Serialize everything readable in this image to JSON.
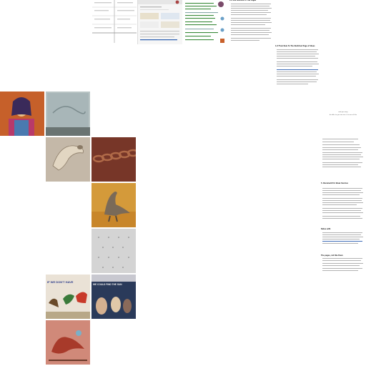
{
  "top_strip": {
    "doc_heading": "1.6 Use Stitched To The Pages",
    "browser_caption": "screenshots"
  },
  "middle_block": {
    "heading": "1.6 From Rule To The Sketched Page of Ideas"
  },
  "right_column": {
    "caption_line1": "and you may",
    "caption_line2": "be able to you can see it is one of this",
    "section_a": "5. Document for Ideas Sources",
    "section_b": "Notes with",
    "section_c": "The pages, not like them"
  },
  "gallery": [
    {
      "name": "portrait-painting",
      "caption": ""
    },
    {
      "name": "stone-relief",
      "caption": ""
    },
    {
      "name": "clay-sculpture",
      "caption": ""
    },
    {
      "name": "chain-links",
      "caption": ""
    },
    {
      "name": "dinosaur-figure",
      "caption": ""
    },
    {
      "name": "dotted-paper",
      "caption": ""
    },
    {
      "name": "mural-1",
      "caption": "IF WE DON'T HAVE"
    },
    {
      "name": "mural-2",
      "caption": "WE COULD FIND THE SUN"
    },
    {
      "name": "dino-mural",
      "caption": ""
    }
  ],
  "colors": {
    "bg": "#ffffff",
    "text": "#444444",
    "accent_green": "#3a8a3a",
    "accent_blue": "#2a5db0"
  }
}
